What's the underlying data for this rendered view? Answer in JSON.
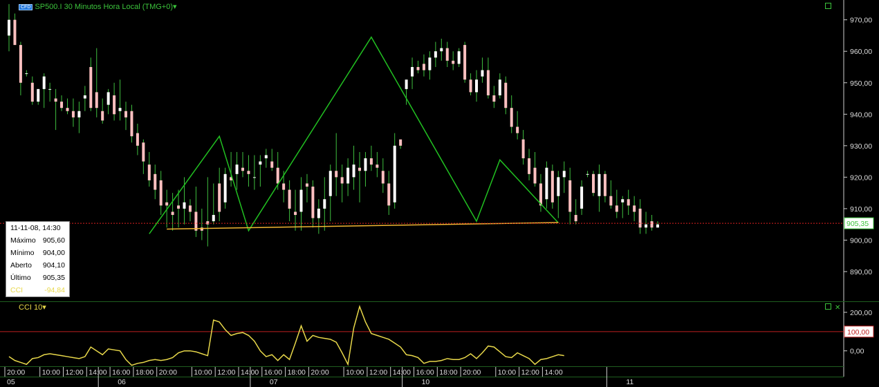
{
  "header": {
    "badge": "CFD",
    "title": "SP500.I 30 Minutos Hora Local (TMG+0)",
    "dropdown_icon": "chevron-down-icon"
  },
  "info_box": {
    "date": "11-11-08, 14:30",
    "rows": [
      {
        "label": "Máximo",
        "value": "905,60"
      },
      {
        "label": "Mínimo",
        "value": "904,00"
      },
      {
        "label": "Aberto",
        "value": "904,10"
      },
      {
        "label": "Último",
        "value": "905,35"
      }
    ],
    "cci_label": "CCI",
    "cci_value": "-94,84"
  },
  "indicator": {
    "label": "CCI 10",
    "dropdown_icon": "chevron-down-icon"
  },
  "colors": {
    "background": "#000000",
    "up_candle": "#ffffff",
    "down_candle": "#ffc0c0",
    "wick": "#3fbf3f",
    "zigzag": "#21c021",
    "neckline": "#f2b632",
    "price_line": "#e02020",
    "cci_line": "#e8d84a",
    "cci_level": "#c02020",
    "axis_text": "#dddddd",
    "grid_separator": "#1f5f1f"
  },
  "chart_data": [
    {
      "type": "candlestick",
      "title": "SP500.I 30 Minutos Hora Local (TMG+0)",
      "y_ticks": [
        890,
        900,
        910,
        920,
        930,
        940,
        950,
        960,
        970
      ],
      "y_tick_labels": [
        "890,00",
        "900,00",
        "910,00",
        "920,00",
        "930,00",
        "940,00",
        "950,00",
        "960,00",
        "970,00"
      ],
      "ylim": [
        881,
        973
      ],
      "last_price": 905.35,
      "last_price_label": "905,35",
      "candles": [
        [
          965,
          975,
          960,
          970
        ],
        [
          970,
          972,
          962,
          962
        ],
        [
          962,
          963,
          946,
          950
        ],
        [
          953,
          954,
          952,
          953
        ],
        [
          950,
          952,
          943,
          944
        ],
        [
          944,
          948,
          943,
          948
        ],
        [
          948,
          953,
          942,
          952
        ],
        [
          948,
          950,
          944,
          948
        ],
        [
          945,
          948,
          935,
          944
        ],
        [
          944,
          946,
          941,
          942
        ],
        [
          942,
          945,
          940,
          941
        ],
        [
          941,
          945,
          936,
          939
        ],
        [
          939,
          944,
          934,
          941
        ],
        [
          945,
          949,
          941,
          946
        ],
        [
          955,
          958,
          941,
          942
        ],
        [
          947,
          961,
          939,
          942
        ],
        [
          941,
          945,
          937,
          938
        ],
        [
          943,
          948,
          940,
          947
        ],
        [
          946,
          950,
          938,
          940
        ],
        [
          941,
          951,
          938,
          942
        ],
        [
          941,
          944,
          935,
          939
        ],
        [
          941,
          943,
          931,
          933
        ],
        [
          934,
          937,
          927,
          930
        ],
        [
          931,
          932,
          921,
          925
        ],
        [
          924,
          928,
          917,
          919
        ],
        [
          921,
          924,
          913,
          916
        ],
        [
          919,
          922,
          908,
          911
        ],
        [
          912,
          916,
          904,
          911
        ],
        [
          909,
          915,
          903,
          908
        ],
        [
          911,
          916,
          904,
          910
        ],
        [
          910,
          920,
          905,
          912
        ],
        [
          911,
          913,
          906,
          909
        ],
        [
          909,
          917,
          901,
          903
        ],
        [
          904,
          910,
          900,
          903
        ],
        [
          906,
          920,
          898,
          905
        ],
        [
          906,
          918,
          905,
          908
        ],
        [
          918,
          923,
          906,
          909
        ],
        [
          912,
          923,
          910,
          921
        ],
        [
          920,
          928,
          917,
          919
        ],
        [
          921,
          928,
          916,
          924
        ],
        [
          923,
          928,
          920,
          922
        ],
        [
          922,
          927,
          917,
          921
        ],
        [
          920,
          927,
          916,
          920
        ],
        [
          924,
          927,
          917,
          925
        ],
        [
          926,
          929,
          923,
          927
        ],
        [
          925,
          929,
          922,
          923
        ],
        [
          923,
          928,
          916,
          918
        ],
        [
          918,
          922,
          912,
          916
        ],
        [
          916,
          919,
          906,
          910
        ],
        [
          909,
          916,
          903,
          908
        ],
        [
          909,
          920,
          903,
          916
        ],
        [
          918,
          921,
          912,
          917
        ],
        [
          917,
          919,
          904,
          907
        ],
        [
          907,
          913,
          902,
          910
        ],
        [
          910,
          920,
          903,
          913
        ],
        [
          914,
          924,
          906,
          922
        ],
        [
          922,
          934,
          914,
          920
        ],
        [
          920,
          924,
          912,
          918
        ],
        [
          918,
          926,
          914,
          923
        ],
        [
          920,
          930,
          916,
          924
        ],
        [
          923,
          928,
          912,
          922
        ],
        [
          922,
          928,
          917,
          926
        ],
        [
          926,
          930,
          922,
          924
        ],
        [
          924,
          928,
          920,
          923
        ],
        [
          922,
          926,
          915,
          918
        ],
        [
          918,
          922,
          908,
          911
        ],
        [
          912,
          934,
          910,
          930
        ],
        [
          932,
          931,
          929,
          930
        ],
        [
          948,
          951,
          943,
          951
        ],
        [
          952,
          958,
          948,
          955
        ],
        [
          955,
          957,
          953,
          954
        ],
        [
          956,
          959,
          952,
          954
        ],
        [
          954,
          960,
          951,
          958
        ],
        [
          958,
          963,
          955,
          960
        ],
        [
          960,
          964,
          957,
          961
        ],
        [
          961,
          963,
          955,
          957
        ],
        [
          957,
          960,
          954,
          956
        ],
        [
          956,
          961,
          955,
          960
        ],
        [
          962,
          963,
          950,
          951
        ],
        [
          951,
          953,
          946,
          947
        ],
        [
          947,
          954,
          944,
          951
        ],
        [
          952,
          958,
          950,
          954
        ],
        [
          954,
          958,
          945,
          946
        ],
        [
          946,
          949,
          942,
          944
        ],
        [
          946,
          953,
          945,
          951
        ],
        [
          950,
          952,
          940,
          942
        ],
        [
          942,
          946,
          934,
          936
        ],
        [
          936,
          941,
          932,
          934
        ],
        [
          932,
          935,
          924,
          926
        ],
        [
          926,
          929,
          919,
          921
        ],
        [
          923,
          928,
          917,
          918
        ],
        [
          918,
          921,
          909,
          911
        ],
        [
          913,
          925,
          910,
          923
        ],
        [
          922,
          924,
          910,
          912
        ],
        [
          914,
          922,
          907,
          920
        ],
        [
          920,
          925,
          915,
          922
        ],
        [
          919,
          923,
          905,
          909
        ],
        [
          908,
          913,
          905,
          906
        ],
        [
          910,
          919,
          908,
          917
        ],
        [
          921,
          922,
          920,
          921
        ],
        [
          921,
          922,
          914,
          915
        ],
        [
          914,
          924,
          909,
          921
        ],
        [
          921,
          922,
          912,
          914
        ],
        [
          914,
          919,
          910,
          911
        ],
        [
          911,
          916,
          907,
          909
        ],
        [
          912,
          914,
          907,
          913
        ],
        [
          913,
          916,
          908,
          911
        ],
        [
          911,
          914,
          906,
          909
        ],
        [
          910,
          913,
          902,
          904
        ],
        [
          904,
          909,
          902,
          905
        ],
        [
          906,
          908,
          903,
          904
        ],
        [
          904,
          906,
          904,
          905
        ]
      ]
    },
    {
      "type": "line",
      "title": "CCI 10",
      "y_tick_labels": [
        "0,00",
        "100,00",
        "200,00"
      ],
      "y_ticks": [
        0,
        100,
        200
      ],
      "ylim": [
        -80,
        250
      ],
      "level": 100,
      "level_label": "100,00",
      "values": [
        -30,
        -50,
        -60,
        -70,
        -40,
        -35,
        -20,
        -15,
        -20,
        -25,
        -30,
        -35,
        -40,
        -30,
        20,
        0,
        -20,
        10,
        5,
        0,
        -45,
        -75,
        -65,
        -60,
        -50,
        -45,
        -50,
        -45,
        -35,
        -10,
        0,
        0,
        -5,
        -15,
        -25,
        160,
        150,
        110,
        80,
        90,
        95,
        80,
        50,
        0,
        -30,
        -20,
        -50,
        -20,
        -45,
        40,
        130,
        50,
        80,
        70,
        65,
        60,
        45,
        -10,
        -70,
        120,
        230,
        150,
        90,
        80,
        70,
        60,
        40,
        20,
        -20,
        -25,
        -35,
        -65,
        -55,
        -55,
        -50,
        -40,
        -45,
        -45,
        -35,
        -15,
        -40,
        -10,
        25,
        20,
        -5,
        -30,
        -35,
        -10,
        -25,
        -40,
        -70,
        -45,
        -40,
        -30,
        -20,
        -25
      ]
    }
  ],
  "time_axis": {
    "labels": [
      {
        "i": 0,
        "text": "20:00"
      },
      {
        "i": 6,
        "text": "10:00"
      },
      {
        "i": 10,
        "text": "12:00"
      },
      {
        "i": 14,
        "text": "14:00"
      },
      {
        "i": 18,
        "text": "16:00"
      },
      {
        "i": 22,
        "text": "18:00"
      },
      {
        "i": 26,
        "text": "20:00"
      },
      {
        "i": 32,
        "text": "10:00"
      },
      {
        "i": 36,
        "text": "12:00"
      },
      {
        "i": 40,
        "text": "14:00"
      },
      {
        "i": 44,
        "text": "16:00"
      },
      {
        "i": 48,
        "text": "18:00"
      },
      {
        "i": 52,
        "text": "20:00"
      },
      {
        "i": 58,
        "text": "10:00"
      },
      {
        "i": 62,
        "text": "12:00"
      },
      {
        "i": 66,
        "text": "14:00"
      },
      {
        "i": 70,
        "text": "16:00"
      },
      {
        "i": 74,
        "text": "18:00"
      },
      {
        "i": 78,
        "text": "20:00"
      },
      {
        "i": 84,
        "text": "10:00"
      },
      {
        "i": 88,
        "text": "12:00"
      },
      {
        "i": 92,
        "text": "14:00"
      }
    ],
    "days": [
      {
        "i": 0,
        "text": "05"
      },
      {
        "i": 16,
        "text": "06"
      },
      {
        "i": 42,
        "text": "07"
      },
      {
        "i": 68,
        "text": "10"
      },
      {
        "i": 103,
        "text": "11"
      }
    ]
  },
  "zigzag": [
    {
      "i": 24,
      "p": 902
    },
    {
      "i": 36,
      "p": 933
    },
    {
      "i": 41,
      "p": 903
    },
    {
      "i": 62,
      "p": 964.5
    },
    {
      "i": 80,
      "p": 906
    },
    {
      "i": 84,
      "p": 925.5
    },
    {
      "i": 94,
      "p": 905.5
    }
  ],
  "neckline": [
    {
      "i": 27,
      "p": 903.5
    },
    {
      "i": 94,
      "p": 905.6
    }
  ]
}
